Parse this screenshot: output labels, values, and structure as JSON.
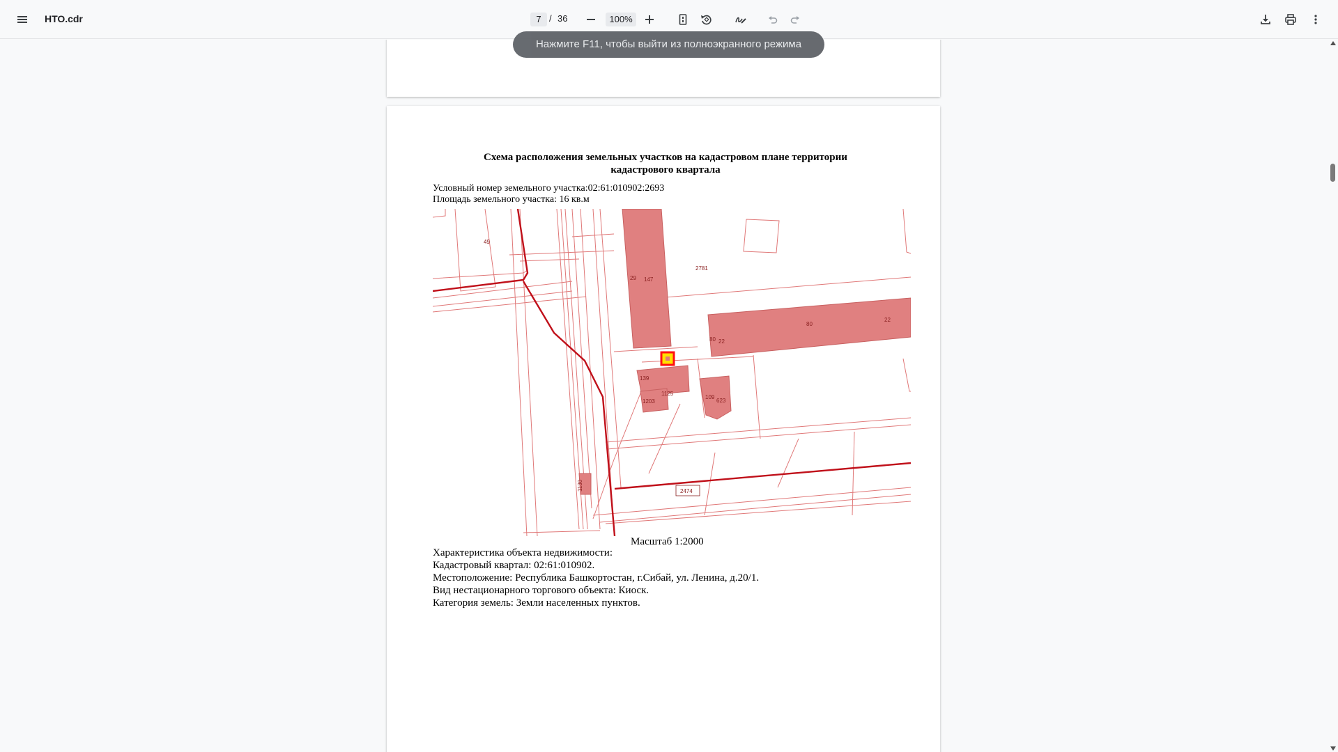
{
  "toolbar": {
    "menu_icon": "hamburger-menu-icon",
    "file_name": "НТО.cdr",
    "current_page": "7",
    "page_separator": "/",
    "total_pages": "36",
    "zoom": "100%",
    "right_icons": [
      "download-icon",
      "print-icon",
      "more-vert-icon"
    ]
  },
  "toast": {
    "text": "Нажмите F11, чтобы выйти из полноэкранного режима"
  },
  "document": {
    "title_line1": "Схема расположения земельных участков на кадастровом плане территории",
    "title_line2": "кадастрового квартала",
    "plot_number": "Условный номер земельного участка:02:61:010902:2693",
    "plot_area": "Площадь земельного участка: 16 кв.м",
    "scale": "Масштаб 1:2000",
    "characteristics_heading": "Характеристика объекта недвижимости:",
    "cadastral_quarter": "Кадастровый квартал: 02:61:010902.",
    "location": "Местоположение: Республика Башкортостан, г.Сибай, ул. Ленина, д.20/1.",
    "object_type": "Вид нестационарного торгового объекта: Киоск.",
    "land_category": "Категория земель: Земли населенных пунктов."
  },
  "map": {
    "labels": [
      "49",
      "29",
      "147",
      "2781",
      "80",
      "22",
      "80",
      "22",
      "139",
      "1203",
      "1125",
      "109",
      "623",
      "2474",
      "1130"
    ],
    "colors": {
      "line": "#e07878",
      "parcel_fill": "#e08080",
      "boundary": "#c0101a",
      "highlight": "#ff1010",
      "highlight_fill": "#ffe000"
    }
  }
}
